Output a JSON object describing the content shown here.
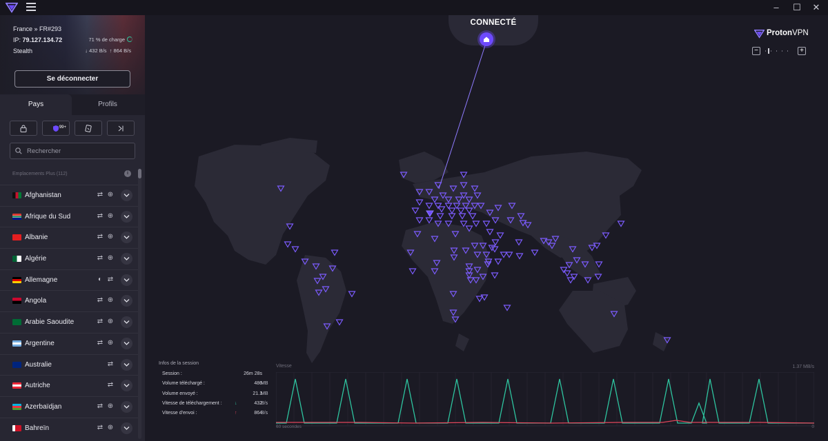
{
  "connection": {
    "server": "France » FR#293",
    "ip_label": "IP:",
    "ip": "79.127.134.72",
    "protocol": "Stealth",
    "load": "71 % de charge",
    "load_fraction": 0.71,
    "download": "↓ 432 B/s",
    "upload": "↑ 864 B/s",
    "disconnect_label": "Se déconnecter"
  },
  "tabs": {
    "countries": "Pays",
    "profiles": "Profils"
  },
  "filters": {
    "p2p_badge": "99+"
  },
  "search": {
    "placeholder": "Rechercher"
  },
  "list_header": "Emplacements Plus (112)",
  "countries": [
    {
      "name": "Afghanistan",
      "icons": [
        "repeat",
        "globe"
      ]
    },
    {
      "name": "Afrique du Sud",
      "icons": [
        "repeat",
        "globe"
      ]
    },
    {
      "name": "Albanie",
      "icons": [
        "repeat",
        "globe"
      ]
    },
    {
      "name": "Algérie",
      "icons": [
        "repeat",
        "globe"
      ]
    },
    {
      "name": "Allemagne",
      "icons": [
        "contrast",
        "repeat"
      ]
    },
    {
      "name": "Angola",
      "icons": [
        "repeat",
        "globe"
      ]
    },
    {
      "name": "Arabie Saoudite",
      "icons": [
        "repeat",
        "globe"
      ]
    },
    {
      "name": "Argentine",
      "icons": [
        "repeat",
        "globe"
      ]
    },
    {
      "name": "Australie",
      "icons": [
        "repeat"
      ]
    },
    {
      "name": "Autriche",
      "icons": [
        "repeat"
      ]
    },
    {
      "name": "Azerbaïdjan",
      "icons": [
        "repeat",
        "globe"
      ]
    },
    {
      "name": "Bahreïn",
      "icons": [
        "repeat",
        "globe"
      ]
    }
  ],
  "map": {
    "status": "CONNECTÉ",
    "zoom_level": 0.1
  },
  "brand": {
    "name_bold": "Proton",
    "name_light": "VPN"
  },
  "session": {
    "title": "Infos de la session",
    "rows": [
      {
        "label": "Session :",
        "value": "26m 28s",
        "unit": ""
      },
      {
        "label": "Volume téléchargé :",
        "value": "486",
        "unit": "MB"
      },
      {
        "label": "Volume envoyé :",
        "value": "21.1",
        "unit": "MB"
      },
      {
        "label": "Vitesse de téléchargement :",
        "value": "432",
        "unit": "B/s"
      },
      {
        "label": "Vitesse d'envoi :",
        "value": "864",
        "unit": "B/s"
      }
    ]
  },
  "speed_chart": {
    "title": "Vitesse",
    "max_label": "1.37  MB/s",
    "x_label": "60 secondes",
    "x_end_label": "0",
    "download_color": "#2ec5a0",
    "upload_color": "#e0455a"
  },
  "colors": {
    "accent": "#6d4aff",
    "download": "#2ec5a0",
    "upload": "#e0455a"
  }
}
